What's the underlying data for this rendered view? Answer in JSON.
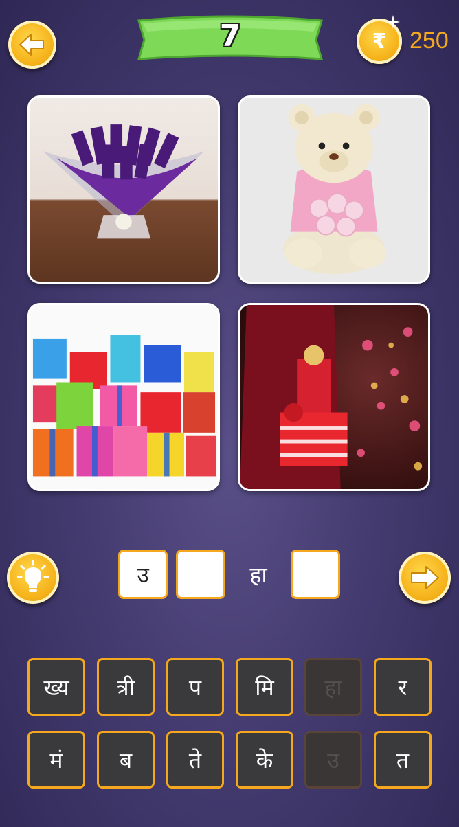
{
  "header": {
    "level": "7",
    "coins": "250",
    "coin_symbol": "₹"
  },
  "icons": {
    "back": "arrow-left-icon",
    "hint": "lightbulb-icon",
    "next": "arrow-right-icon",
    "coin": "rupee-coin-icon"
  },
  "images": [
    {
      "name": "chocolate-bouquet"
    },
    {
      "name": "teddy-bear-with-roses"
    },
    {
      "name": "pile-of-gift-boxes"
    },
    {
      "name": "woman-holding-gifts"
    }
  ],
  "answer": {
    "slots": [
      "उ",
      "",
      "",
      ""
    ],
    "fixed_letter": "हा"
  },
  "keyboard": {
    "row1": [
      {
        "label": "ख्य",
        "used": false
      },
      {
        "label": "त्री",
        "used": false
      },
      {
        "label": "प",
        "used": false
      },
      {
        "label": "मि",
        "used": false
      },
      {
        "label": "हा",
        "used": true
      },
      {
        "label": "र",
        "used": false
      }
    ],
    "row2": [
      {
        "label": "मं",
        "used": false
      },
      {
        "label": "ब",
        "used": false
      },
      {
        "label": "ते",
        "used": false
      },
      {
        "label": "के",
        "used": false
      },
      {
        "label": "उ",
        "used": true
      },
      {
        "label": "त",
        "used": false
      }
    ]
  },
  "colors": {
    "accent_orange": "#f5a81e",
    "banner_green": "#7ed957",
    "background": "#443b70"
  }
}
